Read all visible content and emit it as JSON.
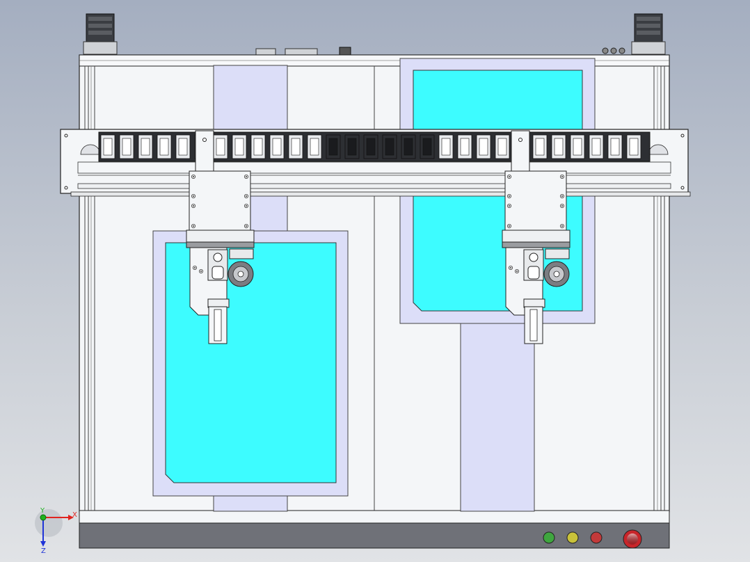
{
  "view": {
    "background_top": "#a4aec0",
    "background_bottom": "#e1e3e6",
    "frame_color": "#f4f6f8",
    "glass_color": "#3dfcff",
    "plate_color": "#dcdef8",
    "panel_color": "#6f7178",
    "chain_color": "#2d2f33"
  },
  "triad": {
    "x_label": "X",
    "y_label": "Y",
    "z_label": "Z",
    "x_color": "#e0231f",
    "y_color": "#1fb21f",
    "z_color": "#2034d8"
  },
  "control_panel": {
    "lamps": [
      {
        "name": "green-indicator-lamp",
        "color": "#3fa63f"
      },
      {
        "name": "yellow-indicator-lamp",
        "color": "#c9c23a"
      },
      {
        "name": "red-indicator-lamp",
        "color": "#c23a3a"
      }
    ],
    "emergency_stop_color": "#c8252a"
  },
  "print_heads": [
    {
      "name": "print-head-left"
    },
    {
      "name": "print-head-right"
    }
  ]
}
